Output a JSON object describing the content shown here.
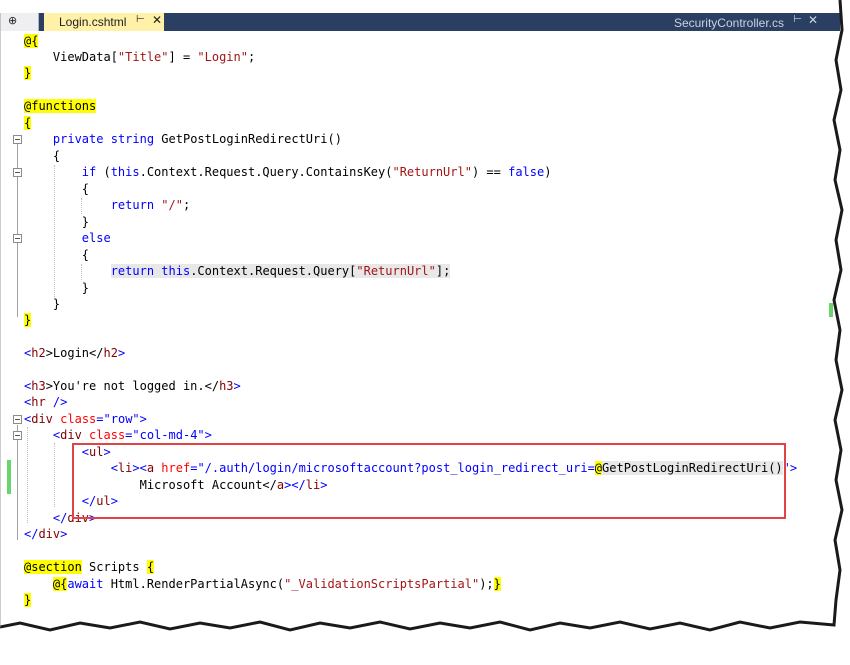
{
  "tabs": {
    "pin_label": "⊕",
    "active": {
      "label": "Login.cshtml",
      "pin": "⊢",
      "close": "✕"
    },
    "other": {
      "label": "SecurityController.cs",
      "pin": "⊢",
      "close": "✕"
    }
  },
  "colors": {
    "keyword": "#0000ff",
    "string": "#a31515",
    "tag": "#800000",
    "attribute": "#ff0000",
    "razor_highlight": "#ffff00",
    "tab_bar": "#2b3f63",
    "active_tab": "#fff1a8",
    "highlight_box": "#e04444"
  },
  "code": {
    "l1": "@{",
    "l2a": "    ViewData[",
    "l2b": "\"Title\"",
    "l2c": "] = ",
    "l2d": "\"Login\"",
    "l2e": ";",
    "l3": "}",
    "l5": "@functions",
    "l6": "{",
    "l7a": "    ",
    "l7b": "private",
    "l7c": " ",
    "l7d": "string",
    "l7e": " GetPostLoginRedirectUri()",
    "l8": "    {",
    "l9a": "        ",
    "l9b": "if",
    "l9c": " (",
    "l9d": "this",
    "l9e": ".Context.Request.Query.ContainsKey(",
    "l9f": "\"ReturnUrl\"",
    "l9g": ") == ",
    "l9h": "false",
    "l9i": ")",
    "l10": "        {",
    "l11a": "            ",
    "l11b": "return",
    "l11c": " ",
    "l11d": "\"/\"",
    "l11e": ";",
    "l12": "        }",
    "l13a": "        ",
    "l13b": "else",
    "l14": "        {",
    "l15a": "            ",
    "l15b": "return",
    "l15c": " ",
    "l15d": "this",
    "l15e": ".Context.Request.Query[",
    "l15f": "\"ReturnUrl\"",
    "l15g": "];",
    "l16": "        }",
    "l17": "    }",
    "l18": "}",
    "l20a": "<",
    "l20b": "h2",
    "l20c": ">Login</",
    "l20d": "h2",
    "l20e": ">",
    "l22a": "<",
    "l22b": "h3",
    "l22c": ">You're not logged in.</",
    "l22d": "h3",
    "l22e": ">",
    "l23a": "<",
    "l23b": "hr",
    "l23c": " />",
    "l24a": "<",
    "l24b": "div",
    "l24c": " ",
    "l24d": "class",
    "l24e": "=",
    "l24f": "\"row\"",
    "l24g": ">",
    "l25a": "    <",
    "l25b": "div",
    "l25c": " ",
    "l25d": "class",
    "l25e": "=",
    "l25f": "\"col-md-4\"",
    "l25g": ">",
    "l26a": "        <",
    "l26b": "ul",
    "l26c": ">",
    "l27a": "            <",
    "l27b": "li",
    "l27c": "><",
    "l27d": "a",
    "l27e": " ",
    "l27f": "href",
    "l27g": "=",
    "l27h": "\"/.auth/login/microsoftaccount?post_login_redirect_uri=",
    "l27i": "@",
    "l27j": "GetPostLoginRedirectUri()",
    "l27k": "\"",
    "l27l": ">",
    "l28a": "                Microsoft Account</",
    "l28b": "a",
    "l28c": "></",
    "l28d": "li",
    "l28e": ">",
    "l29a": "        </",
    "l29b": "ul",
    "l29c": ">",
    "l30a": "    </",
    "l30b": "div",
    "l30c": ">",
    "l31a": "</",
    "l31b": "div",
    "l31c": ">",
    "l33a": "@section",
    "l33b": " Scripts ",
    "l33c": "{",
    "l34a": "    ",
    "l34b": "@{",
    "l34c": "await",
    "l34d": " Html.RenderPartialAsync(",
    "l34e": "\"_ValidationScriptsPartial\"",
    "l34f": ");",
    "l34g": "}",
    "l35": "}"
  }
}
